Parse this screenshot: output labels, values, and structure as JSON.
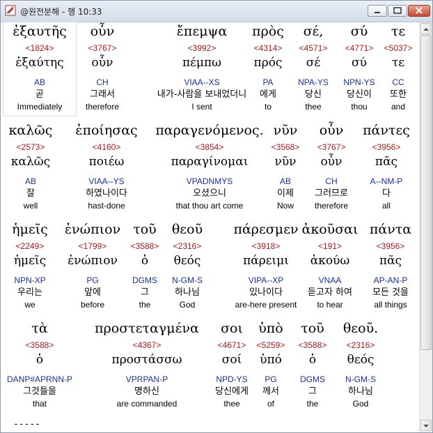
{
  "window": {
    "title": "@원전분해 - 행 10:33",
    "minimize_icon": "minimize-icon",
    "maximize_icon": "maximize-icon",
    "close_icon": "close-icon"
  },
  "colors": {
    "strongs": "#b0151a",
    "parsing": "#1a2fa0",
    "text": "#000000"
  },
  "rows": [
    {
      "words": [
        {
          "greek": "ἐξαυτῆς",
          "num": "<1824>",
          "lemma": "ἐξαύτης",
          "parse": "AB",
          "korean": "곧",
          "english": "Immediately"
        },
        {
          "greek": "οὖν",
          "num": "<3767>",
          "lemma": "οὖν",
          "parse": "CH",
          "korean": "그래서",
          "english": "therefore"
        },
        {
          "greek": "ἔπεμψα",
          "num": "<3992>",
          "lemma": "πέμπω",
          "parse": "VIAA--XS",
          "korean": "내가-사람을 보내었더니",
          "english": "I sent"
        },
        {
          "greek": "πρὸς",
          "num": "<4314>",
          "lemma": "πρός",
          "parse": "PA",
          "korean": "에게",
          "english": "to"
        },
        {
          "greek": "σέ,",
          "num": "<4571>",
          "lemma": "σέ",
          "parse": "NPA-YS",
          "korean": "당신",
          "english": "thee"
        },
        {
          "greek": "σύ",
          "num": "<4771>",
          "lemma": "σύ",
          "parse": "NPN-YS",
          "korean": "당신이",
          "english": "thou"
        },
        {
          "greek": "τε",
          "num": "<5037>",
          "lemma": "τε",
          "parse": "CC",
          "korean": "또한",
          "english": "and"
        }
      ]
    },
    {
      "words": [
        {
          "greek": "καλῶς",
          "num": "<2573>",
          "lemma": "καλῶς",
          "parse": "AB",
          "korean": "잘",
          "english": "well"
        },
        {
          "greek": "ἐποίησας",
          "num": "<4160>",
          "lemma": "ποιέω",
          "parse": "VIAA--YS",
          "korean": "하였나이다",
          "english": "hast-done"
        },
        {
          "greek": "παραγενόμενος.",
          "num": "<3854>",
          "lemma": "παραγίνομαι",
          "parse": "VPADNMYS",
          "korean": "오셨으니",
          "english": "that thou art come"
        },
        {
          "greek": "νῦν",
          "num": "<3568>",
          "lemma": "νῦν",
          "parse": "AB",
          "korean": "이제",
          "english": "Now"
        },
        {
          "greek": "οὖν",
          "num": "<3767>",
          "lemma": "οὖν",
          "parse": "CH",
          "korean": "그러므로",
          "english": "therefore"
        },
        {
          "greek": "πάντες",
          "num": "<3956>",
          "lemma": "πᾶς",
          "parse": "A--NM-P",
          "korean": "다",
          "english": "all"
        }
      ]
    },
    {
      "words": [
        {
          "greek": "ἡμεῖς",
          "num": "<2249>",
          "lemma": "ἡμεῖς",
          "parse": "NPN-XP",
          "korean": "우리는",
          "english": "we"
        },
        {
          "greek": "ἐνώπιον",
          "num": "<1799>",
          "lemma": "ἐνώπιον",
          "parse": "PG",
          "korean": "앞에",
          "english": "before"
        },
        {
          "greek": "τοῦ",
          "num": "<3588>",
          "lemma": "ὁ",
          "parse": "DGMS",
          "korean": "그",
          "english": "the"
        },
        {
          "greek": "θεοῦ",
          "num": "<2316>",
          "lemma": "θεός",
          "parse": "N-GM-S",
          "korean": "하나님",
          "english": "God"
        },
        {
          "greek": "πάρεσμεν",
          "num": "<3918>",
          "lemma": "πάρειμι",
          "parse": "VIPA--XP",
          "korean": "있나이다",
          "english": "are-here present"
        },
        {
          "greek": "ἀκοῦσαι",
          "num": "<191>",
          "lemma": "ἀκούω",
          "parse": "VNAA",
          "korean": "듣고자 하여",
          "english": "to hear"
        },
        {
          "greek": "πάντα",
          "num": "<3956>",
          "lemma": "πᾶς",
          "parse": "AP-AN-P",
          "korean": "모든 것을",
          "english": "all things"
        }
      ]
    },
    {
      "words": [
        {
          "greek": "τὰ",
          "num": "<3588>",
          "lemma": "ὁ",
          "parse": "DANP#APRNN-P",
          "korean": "그것들을",
          "english": "that"
        },
        {
          "greek": "προστεταγμένα",
          "num": "<4367>",
          "lemma": "προστάσσω",
          "parse": "VPRPAN-P",
          "korean": "명하신",
          "english": "are commanded"
        },
        {
          "greek": "σοι",
          "num": "<4671>",
          "lemma": "σοί",
          "parse": "NPD-YS",
          "korean": "당신에게",
          "english": "thee"
        },
        {
          "greek": "ὑπὸ",
          "num": "<5259>",
          "lemma": "ὑπό",
          "parse": "PG",
          "korean": "께서",
          "english": "of"
        },
        {
          "greek": "τοῦ",
          "num": "<3588>",
          "lemma": "ὁ",
          "parse": "DGMS",
          "korean": "그",
          "english": "the"
        },
        {
          "greek": "θεοῦ.",
          "num": "<2316>",
          "lemma": "θεός",
          "parse": "N-GM-S",
          "korean": "하나님",
          "english": "God"
        }
      ]
    }
  ],
  "footer_dashes": "-----"
}
